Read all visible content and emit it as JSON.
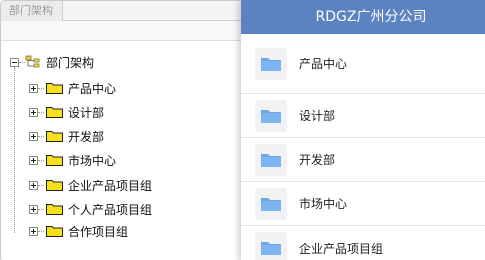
{
  "tab": {
    "title": "部门架构"
  },
  "tree": {
    "root_label": "部门架构",
    "items": [
      {
        "label": "产品中心"
      },
      {
        "label": "设计部"
      },
      {
        "label": "开发部"
      },
      {
        "label": "市场中心"
      },
      {
        "label": "企业产品项目组"
      },
      {
        "label": "个人产品项目组"
      },
      {
        "label": "合作项目组"
      }
    ]
  },
  "panel": {
    "header": "RDGZ广州分公司",
    "items": [
      {
        "label": "产品中心"
      },
      {
        "label": "设计部"
      },
      {
        "label": "开发部"
      },
      {
        "label": "市场中心"
      },
      {
        "label": "企业产品项目组"
      }
    ]
  },
  "colors": {
    "header_bg": "#5b83c2",
    "folder_yellow": "#f5e01a",
    "folder_blue": "#6aa6e8"
  },
  "icons": {
    "tree_folder": "folder-icon",
    "root": "org-tree-icon",
    "card_folder": "blue-folder-icon"
  }
}
